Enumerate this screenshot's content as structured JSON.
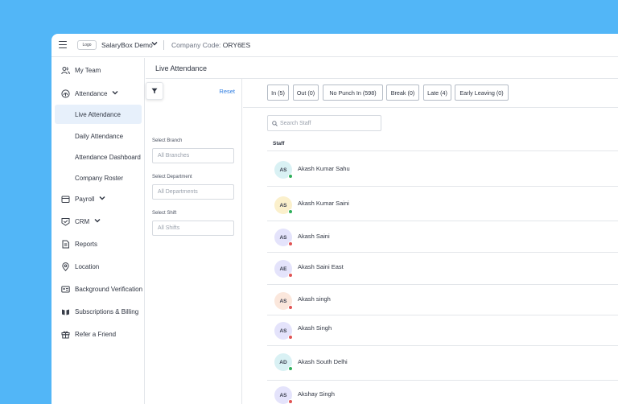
{
  "topbar": {
    "logo_text": "Logo",
    "brand": "SalaryBox Demo",
    "company_code_label": "Company Code:",
    "company_code_value": "ORY6ES"
  },
  "sidebar": {
    "items": [
      {
        "label": "My Team",
        "icon": "team-icon"
      },
      {
        "label": "Attendance",
        "icon": "fingerprint-icon",
        "expanded": true
      },
      {
        "label": "Payroll",
        "icon": "wallet-icon"
      },
      {
        "label": "CRM",
        "icon": "crm-icon"
      },
      {
        "label": "Reports",
        "icon": "document-icon"
      },
      {
        "label": "Location",
        "icon": "location-pin-icon"
      },
      {
        "label": "Background Verification",
        "icon": "id-card-icon"
      },
      {
        "label": "Subscriptions & Billing",
        "icon": "billing-icon"
      },
      {
        "label": "Refer a Friend",
        "icon": "gift-icon"
      }
    ],
    "attendance_sub": [
      {
        "label": "Live Attendance",
        "active": true
      },
      {
        "label": "Daily Attendance"
      },
      {
        "label": "Attendance Dashboard"
      },
      {
        "label": "Company Roster"
      }
    ]
  },
  "main": {
    "title": "Live Attendance"
  },
  "filters": {
    "reset": "Reset",
    "branch_label": "Select Branch",
    "branch_value": "All Branches",
    "department_label": "Select Department",
    "department_value": "All Departments",
    "shift_label": "Select Shift",
    "shift_value": "All Shifts"
  },
  "tabs": [
    "In (5)",
    "Out (0)",
    "No Punch In (598)",
    "Break (0)",
    "Late (4)",
    "Early Leaving (0)"
  ],
  "search": {
    "placeholder": "Search Staff"
  },
  "table": {
    "header": "Staff",
    "rows": [
      {
        "initials": "AS",
        "name": "Akash Kumar Sahu",
        "avatar_color": "#d9f1f4",
        "status_color": "#2eae5a"
      },
      {
        "initials": "AS",
        "name": "Akash Kumar Saini",
        "avatar_color": "#fbf0cc",
        "status_color": "#2eae5a"
      },
      {
        "initials": "AS",
        "name": "Akash Saini",
        "avatar_color": "#e4e3fb",
        "status_color": "#e05353"
      },
      {
        "initials": "AE",
        "name": "Akash Saini East",
        "avatar_color": "#e4e3fb",
        "status_color": "#e05353"
      },
      {
        "initials": "AS",
        "name": "Akash singh",
        "avatar_color": "#fbe7dc",
        "status_color": "#e05353"
      },
      {
        "initials": "AS",
        "name": "Akash Singh",
        "avatar_color": "#e4e3fb",
        "status_color": "#e05353"
      },
      {
        "initials": "AD",
        "name": "Akash South Delhi",
        "avatar_color": "#d9f1f4",
        "status_color": "#2eae5a"
      },
      {
        "initials": "AS",
        "name": "Akshay Singh",
        "avatar_color": "#e4e3fb",
        "status_color": "#e05353"
      }
    ]
  }
}
